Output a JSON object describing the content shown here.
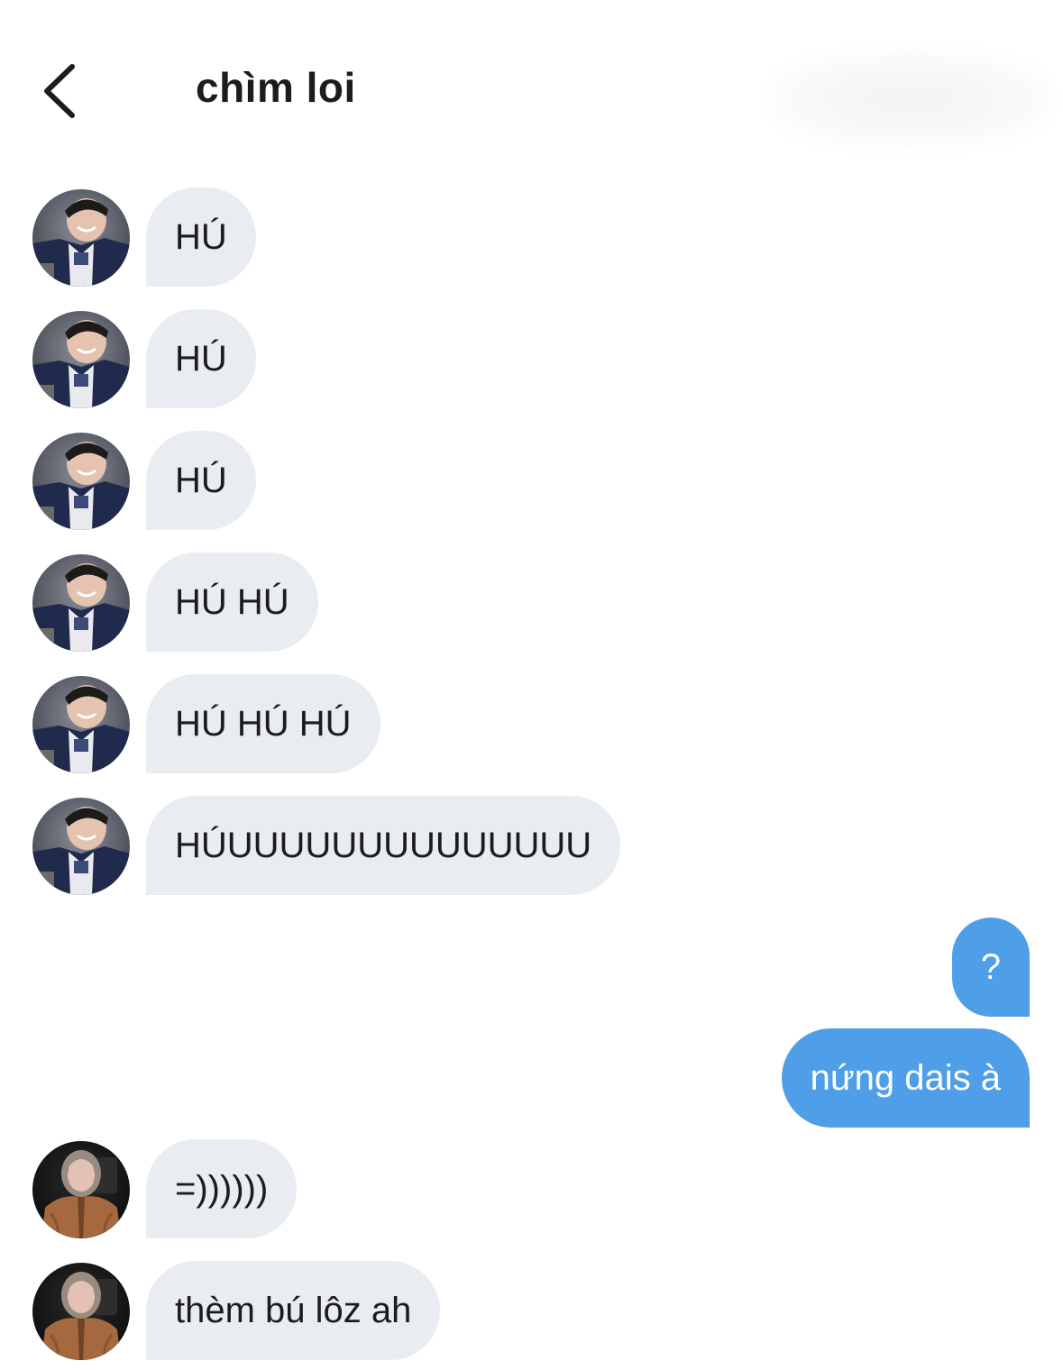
{
  "header": {
    "title": "chìm loi",
    "back_icon": "chevron-left-icon"
  },
  "colors": {
    "incoming_bubble": "#e9ecf0",
    "outgoing_bubble": "#4f9fe8",
    "background": "#ffffff"
  },
  "messages": [
    {
      "direction": "in",
      "avatar": "avatar-navy-sweater",
      "text": "HÚ"
    },
    {
      "direction": "in",
      "avatar": "avatar-navy-sweater",
      "text": "HÚ"
    },
    {
      "direction": "in",
      "avatar": "avatar-navy-sweater",
      "text": "HÚ"
    },
    {
      "direction": "in",
      "avatar": "avatar-navy-sweater",
      "text": "HÚ HÚ"
    },
    {
      "direction": "in",
      "avatar": "avatar-navy-sweater",
      "text": "HÚ HÚ HÚ"
    },
    {
      "direction": "in",
      "avatar": "avatar-navy-sweater",
      "text": "HÚUUUUUUUUUUUUUU"
    },
    {
      "direction": "out",
      "text": "?"
    },
    {
      "direction": "out",
      "text": "nứng dais à"
    },
    {
      "direction": "in",
      "avatar": "avatar-brown-hoodie",
      "text": "=))))))"
    },
    {
      "direction": "in",
      "avatar": "avatar-brown-hoodie",
      "text": "thèm bú lôz ah"
    }
  ]
}
